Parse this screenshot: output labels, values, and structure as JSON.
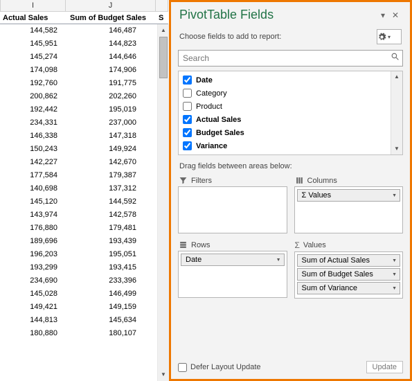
{
  "grid": {
    "col_letters": {
      "c1": "I",
      "c2": "J"
    },
    "headers": {
      "c1": "Actual Sales",
      "c2": "Sum of Budget Sales",
      "c3": "S"
    },
    "rows": [
      {
        "c1": "144,582",
        "c2": "146,487"
      },
      {
        "c1": "145,951",
        "c2": "144,823"
      },
      {
        "c1": "145,274",
        "c2": "144,646"
      },
      {
        "c1": "174,098",
        "c2": "174,906"
      },
      {
        "c1": "192,760",
        "c2": "191,775"
      },
      {
        "c1": "200,862",
        "c2": "202,260"
      },
      {
        "c1": "192,442",
        "c2": "195,019"
      },
      {
        "c1": "234,331",
        "c2": "237,000"
      },
      {
        "c1": "146,338",
        "c2": "147,318"
      },
      {
        "c1": "150,243",
        "c2": "149,924"
      },
      {
        "c1": "142,227",
        "c2": "142,670"
      },
      {
        "c1": "177,584",
        "c2": "179,387"
      },
      {
        "c1": "140,698",
        "c2": "137,312"
      },
      {
        "c1": "145,120",
        "c2": "144,592"
      },
      {
        "c1": "143,974",
        "c2": "142,578"
      },
      {
        "c1": "176,880",
        "c2": "179,481"
      },
      {
        "c1": "189,696",
        "c2": "193,439"
      },
      {
        "c1": "196,203",
        "c2": "195,051"
      },
      {
        "c1": "193,299",
        "c2": "193,415"
      },
      {
        "c1": "234,690",
        "c2": "233,396"
      },
      {
        "c1": "145,028",
        "c2": "146,499"
      },
      {
        "c1": "149,421",
        "c2": "149,159"
      },
      {
        "c1": "144,813",
        "c2": "145,634"
      },
      {
        "c1": "180,880",
        "c2": "180,107"
      }
    ]
  },
  "panel": {
    "title": "PivotTable Fields",
    "subtitle": "Choose fields to add to report:",
    "search_placeholder": "Search",
    "fields": [
      {
        "label": "Date",
        "checked": true,
        "bold": true
      },
      {
        "label": "Category",
        "checked": false,
        "bold": false
      },
      {
        "label": "Product",
        "checked": false,
        "bold": false
      },
      {
        "label": "Actual Sales",
        "checked": true,
        "bold": true
      },
      {
        "label": "Budget Sales",
        "checked": true,
        "bold": true
      },
      {
        "label": "Variance",
        "checked": true,
        "bold": true
      }
    ],
    "drag_tip": "Drag fields between areas below:",
    "quads": {
      "filters": {
        "label": "Filters",
        "items": []
      },
      "columns": {
        "label": "Columns",
        "items": [
          "Σ Values"
        ]
      },
      "rows": {
        "label": "Rows",
        "items": [
          "Date"
        ]
      },
      "values": {
        "label": "Values",
        "items": [
          "Sum of Actual Sales",
          "Sum of Budget Sales",
          "Sum of Variance"
        ]
      }
    },
    "footer": {
      "defer_label": "Defer Layout Update",
      "update_label": "Update"
    }
  }
}
